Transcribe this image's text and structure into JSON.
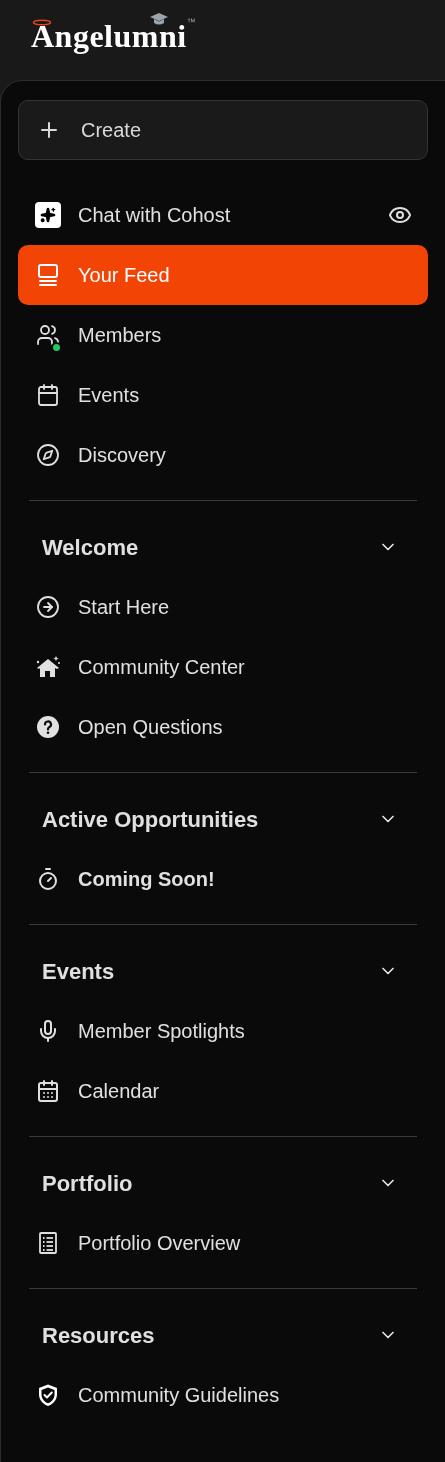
{
  "logo": {
    "name": "Angelumni",
    "trademark": "™"
  },
  "create_button": {
    "label": "Create"
  },
  "nav": [
    {
      "label": "Chat with Cohost",
      "selected": false,
      "online": false,
      "visible_toggle": true
    },
    {
      "label": "Your Feed",
      "selected": true,
      "online": false,
      "visible_toggle": false
    },
    {
      "label": "Members",
      "selected": false,
      "online": true,
      "visible_toggle": false
    },
    {
      "label": "Events",
      "selected": false,
      "online": false,
      "visible_toggle": false
    },
    {
      "label": "Discovery",
      "selected": false,
      "online": false,
      "visible_toggle": false
    }
  ],
  "sections": [
    {
      "title": "Welcome",
      "expanded": true,
      "items": [
        {
          "label": "Start Here",
          "emphasized": false
        },
        {
          "label": "Community Center",
          "emphasized": false
        },
        {
          "label": "Open Questions",
          "emphasized": false
        }
      ]
    },
    {
      "title": "Active Opportunities",
      "expanded": true,
      "items": [
        {
          "label": "Coming Soon!",
          "emphasized": true
        }
      ]
    },
    {
      "title": "Events",
      "expanded": true,
      "items": [
        {
          "label": "Member Spotlights",
          "emphasized": false
        },
        {
          "label": "Calendar",
          "emphasized": false
        }
      ]
    },
    {
      "title": "Portfolio",
      "expanded": true,
      "items": [
        {
          "label": "Portfolio Overview",
          "emphasized": false
        }
      ]
    },
    {
      "title": "Resources",
      "expanded": true,
      "items": [
        {
          "label": "Community Guidelines",
          "emphasized": false
        }
      ]
    }
  ]
}
